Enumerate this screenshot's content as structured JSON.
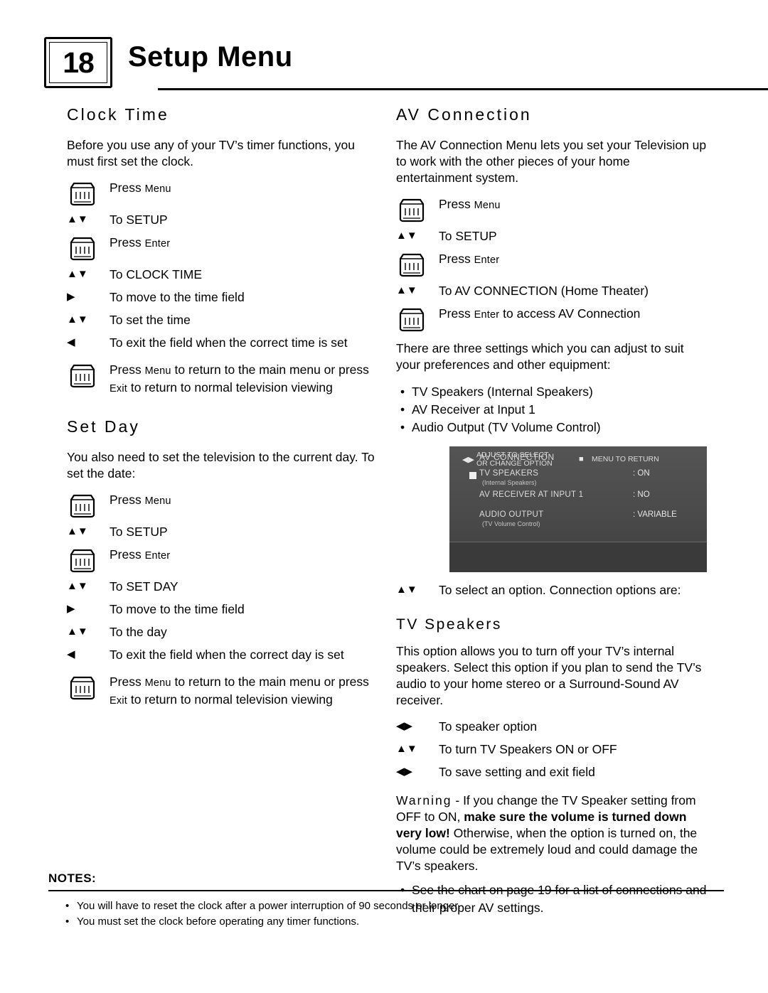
{
  "header": {
    "page_number": "18",
    "title": "Setup Menu"
  },
  "left_column": {
    "clock_time": {
      "heading": "Clock Time",
      "intro": "Before you use any of your TV’s timer functions, you must first set the clock.",
      "steps": [
        {
          "icon": "remote-button-icon",
          "marker": "",
          "text_pre": "Press ",
          "text_sc": "Menu",
          "text_post": ""
        },
        {
          "icon": "",
          "marker": "▲▼",
          "text_pre": "To SETUP",
          "text_sc": "",
          "text_post": ""
        },
        {
          "icon": "remote-button-icon",
          "marker": "",
          "text_pre": "Press ",
          "text_sc": "Enter",
          "text_post": ""
        },
        {
          "icon": "",
          "marker": "▲▼",
          "text_pre": "To CLOCK TIME",
          "text_sc": "",
          "text_post": ""
        },
        {
          "icon": "",
          "marker": "▶",
          "text_pre": "To move to the time field",
          "text_sc": "",
          "text_post": ""
        },
        {
          "icon": "",
          "marker": "▲▼",
          "text_pre": "To set the time",
          "text_sc": "",
          "text_post": ""
        },
        {
          "icon": "",
          "marker": "◀",
          "text_pre": "To exit the field when the correct time is set",
          "text_sc": "",
          "text_post": ""
        },
        {
          "icon": "remote-button-icon",
          "marker": "",
          "text_pre": "Press ",
          "text_sc": "Menu",
          "text_post": " to return to the main menu or press ",
          "text_sc2": "Exit",
          "text_post2": " to return to normal television viewing"
        }
      ]
    },
    "set_day": {
      "heading": "Set Day",
      "intro": "You also need to set the television to the current day. To set the date:",
      "steps": [
        {
          "icon": "remote-button-icon",
          "marker": "",
          "text_pre": "Press ",
          "text_sc": "Menu",
          "text_post": ""
        },
        {
          "icon": "",
          "marker": "▲▼",
          "text_pre": "To SETUP",
          "text_sc": "",
          "text_post": ""
        },
        {
          "icon": "remote-button-icon",
          "marker": "",
          "text_pre": "Press ",
          "text_sc": "Enter",
          "text_post": ""
        },
        {
          "icon": "",
          "marker": "▲▼",
          "text_pre": "To SET DAY",
          "text_sc": "",
          "text_post": ""
        },
        {
          "icon": "",
          "marker": "▶",
          "text_pre": "To move to the time field",
          "text_sc": "",
          "text_post": ""
        },
        {
          "icon": "",
          "marker": "▲▼",
          "text_pre": "To the day",
          "text_sc": "",
          "text_post": ""
        },
        {
          "icon": "",
          "marker": "◀",
          "text_pre": "To exit the field when the correct day is set",
          "text_sc": "",
          "text_post": ""
        },
        {
          "icon": "remote-button-icon",
          "marker": "",
          "text_pre": "Press ",
          "text_sc": "Menu",
          "text_post": " to return to the main menu or press ",
          "text_sc2": "Exit",
          "text_post2": " to return to normal television viewing"
        }
      ]
    }
  },
  "right_column": {
    "av_connection": {
      "heading": "AV Connection",
      "intro": "The AV Connection Menu lets you set your Television up to work with the other pieces of your home entertainment system.",
      "steps": [
        {
          "icon": "remote-button-icon",
          "marker": "",
          "text_pre": "Press ",
          "text_sc": "Menu",
          "text_post": ""
        },
        {
          "icon": "",
          "marker": "▲▼",
          "text_pre": "To SETUP",
          "text_sc": "",
          "text_post": ""
        },
        {
          "icon": "remote-button-icon",
          "marker": "",
          "text_pre": "Press ",
          "text_sc": "Enter",
          "text_post": ""
        },
        {
          "icon": "",
          "marker": "▲▼",
          "text_pre": "To AV CONNECTION (Home Theater)",
          "text_sc": "",
          "text_post": ""
        },
        {
          "icon": "remote-button-icon",
          "marker": "",
          "text_pre": "Press ",
          "text_sc": "Enter",
          "text_post": " to access AV Connection"
        }
      ],
      "settings_intro": "There are three settings which you can adjust to suit your preferences and other equipment:",
      "settings_list": [
        "TV Speakers (Internal Speakers)",
        "AV Receiver at Input 1",
        "Audio Output (TV Volume Control)"
      ],
      "osd": {
        "title": "AV CONNECTION",
        "rows": [
          {
            "label": "TV SPEAKERS",
            "sub": "(Internal Speakers)",
            "value": ": ON"
          },
          {
            "label": "AV RECEIVER AT INPUT 1",
            "sub": "",
            "value": ": NO"
          },
          {
            "label": "AUDIO OUTPUT",
            "sub": "(TV Volume Control)",
            "value": ": VARIABLE"
          }
        ],
        "footer_left_line1": "ADJUST TO SELECT",
        "footer_left_line2": "OR CHANGE OPTION",
        "footer_right": "MENU TO RETURN",
        "footer_icon_left": "◀▶",
        "footer_icon_right": "■"
      },
      "select_option_line": {
        "marker": "▲▼",
        "text": "To select an option. Connection options are:"
      }
    },
    "tv_speakers": {
      "heading": "TV Speakers",
      "body": "This option allows you to turn off your TV’s internal speakers. Select this option if you plan to send the TV’s audio to your home stereo or a Surround-Sound AV receiver.",
      "steps": [
        {
          "marker": "◀▶",
          "text": "To speaker option"
        },
        {
          "marker": "▲▼",
          "text": "To turn TV Speakers ON or OFF"
        },
        {
          "marker": "◀▶",
          "text": "To save setting and exit field"
        }
      ],
      "warning": {
        "label": "Warning",
        "part1": " - If you change the TV Speaker setting from OFF to ON, ",
        "bold": "make sure the volume is turned down very low!",
        "part2": " Otherwise, when the option is turned on, the volume could be extremely loud and could damage the TV’s speakers."
      },
      "see_chart": "See the chart on page 19 for a list of connections and their proper AV settings."
    }
  },
  "notes": {
    "label": "NOTES:",
    "items": [
      "You will have to reset the clock after a power interruption of 90 seconds or longer.",
      "You must set the clock before operating any timer functions."
    ]
  }
}
